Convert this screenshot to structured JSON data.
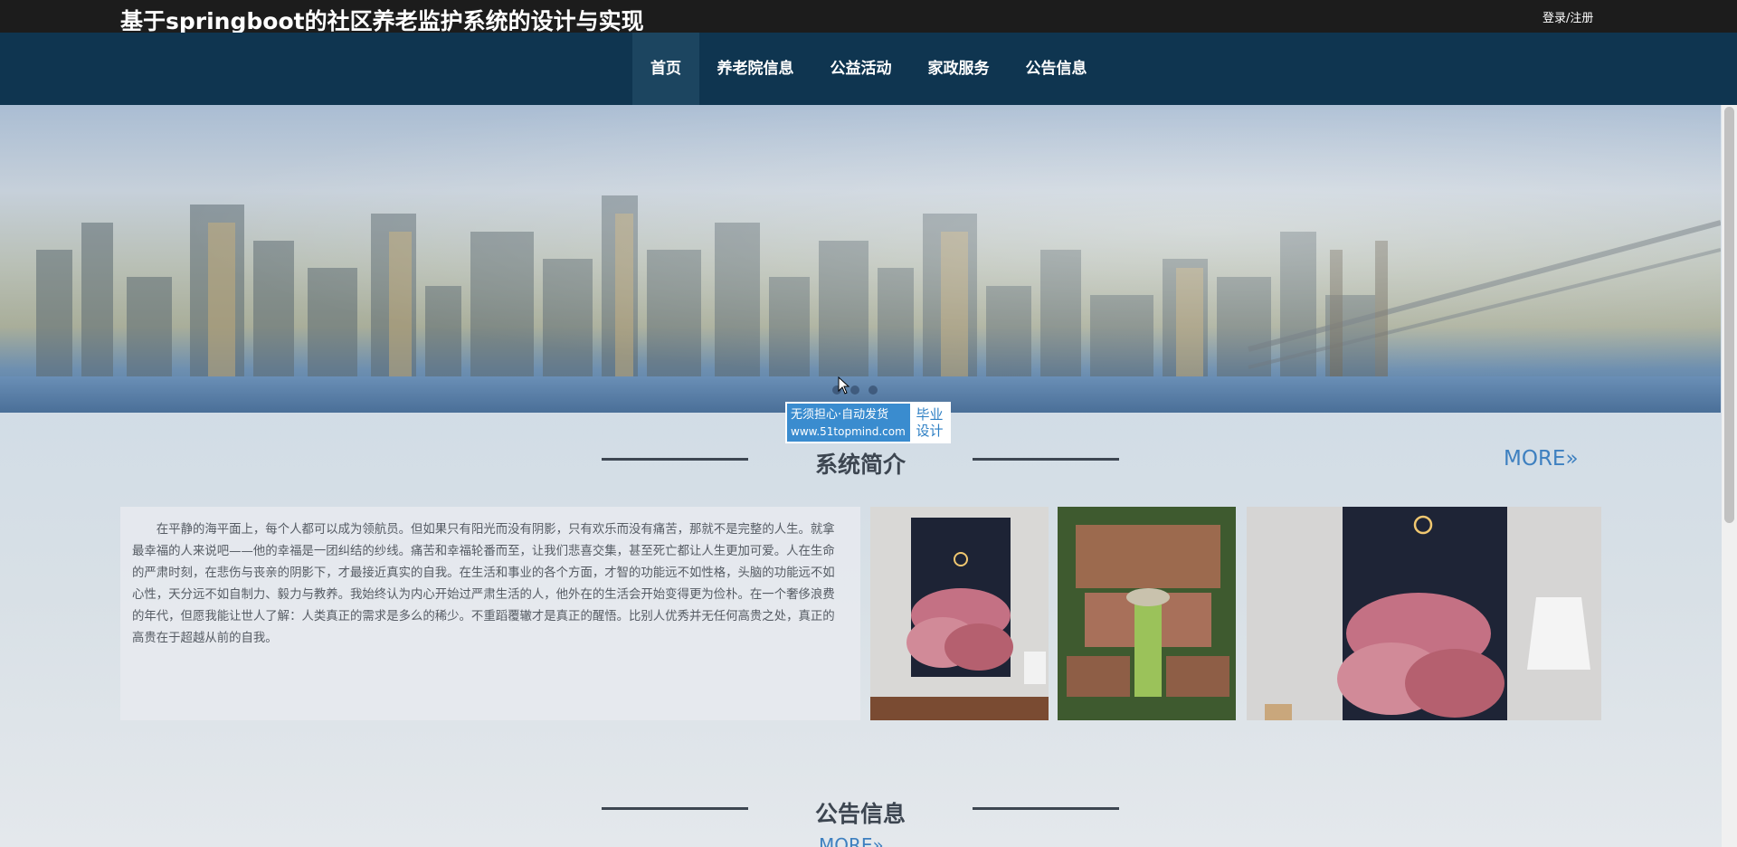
{
  "header": {
    "site_title": "基于springboot的社区养老监护系统的设计与实现",
    "login_label": "登录/注册"
  },
  "nav": {
    "items": [
      {
        "label": "首页",
        "active": true
      },
      {
        "label": "养老院信息",
        "active": false
      },
      {
        "label": "公益活动",
        "active": false
      },
      {
        "label": "家政服务",
        "active": false
      },
      {
        "label": "公告信息",
        "active": false
      }
    ]
  },
  "banner": {
    "slide_count": 3
  },
  "watermark": {
    "line1": "无须担心·自动发货",
    "url": "www.51topmind.com",
    "tag": "毕业设计"
  },
  "intro": {
    "title": "系统简介",
    "more_label": "MORE»",
    "text": "在平静的海平面上，每个人都可以成为领航员。但如果只有阳光而没有阴影，只有欢乐而没有痛苦，那就不是完整的人生。就拿最幸福的人来说吧——他的幸福是一团纠结的纱线。痛苦和幸福轮番而至，让我们悲喜交集，甚至死亡都让人生更加可爱。人在生命的严肃时刻，在悲伤与丧亲的阴影下，才最接近真实的自我。在生活和事业的各个方面，才智的功能远不如性格，头脑的功能远不如心性，天分远不如自制力、毅力与教养。我始终认为内心开始过严肃生活的人，他外在的生活会开始变得更为俭朴。在一个奢侈浪费的年代，但愿我能让世人了解：人类真正的需求是多么的稀少。不重蹈覆辙才是真正的醒悟。比别人优秀并无任何高贵之处，真正的高贵在于超越从前的自我。"
  },
  "notice": {
    "title": "公告信息",
    "more_label": "MORE»"
  },
  "colors": {
    "topbar": "#1c1c1c",
    "navbar": "#0f3550",
    "accent": "#3e80c0"
  }
}
